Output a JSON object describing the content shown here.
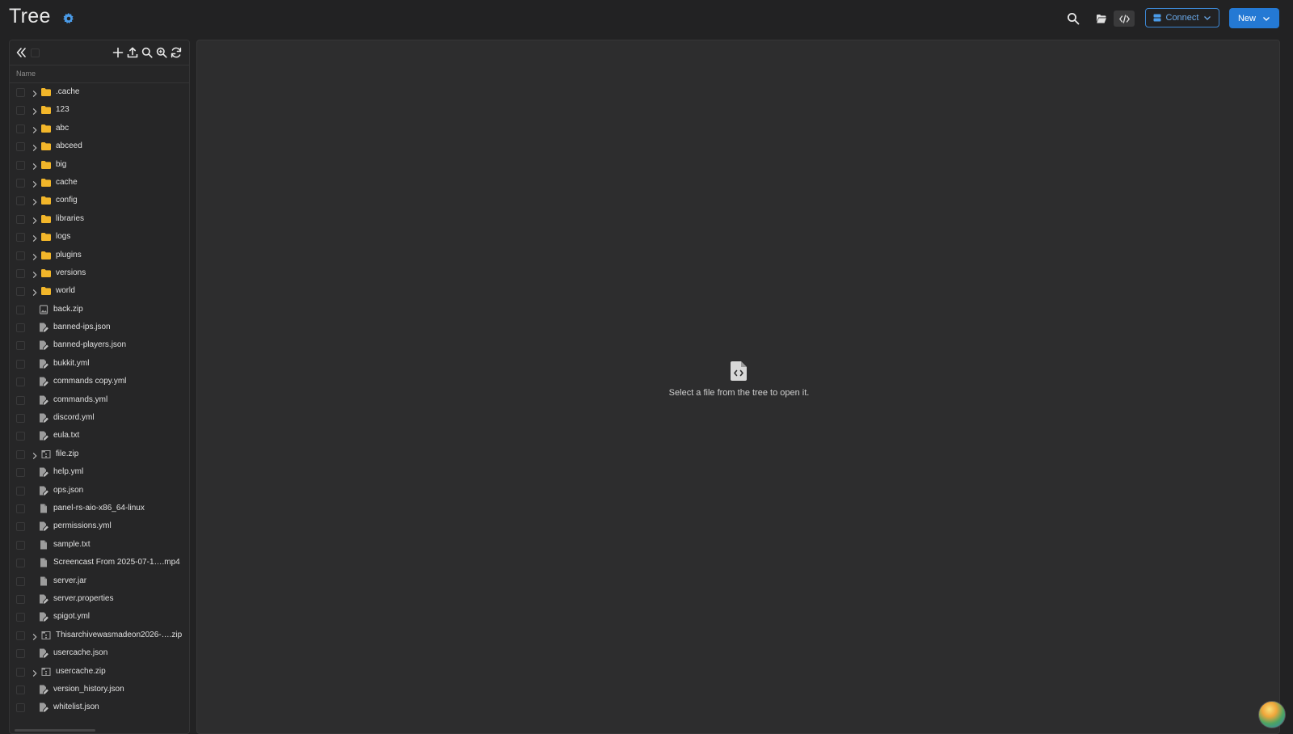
{
  "header": {
    "title": "Tree",
    "connect_label": "Connect",
    "new_label": "New"
  },
  "sidebar": {
    "column_name": "Name"
  },
  "tree": {
    "items": [
      {
        "name": ".cache",
        "kind": "folder"
      },
      {
        "name": "123",
        "kind": "folder"
      },
      {
        "name": "abc",
        "kind": "folder"
      },
      {
        "name": "abceed",
        "kind": "folder"
      },
      {
        "name": "big",
        "kind": "folder"
      },
      {
        "name": "cache",
        "kind": "folder"
      },
      {
        "name": "config",
        "kind": "folder"
      },
      {
        "name": "libraries",
        "kind": "folder"
      },
      {
        "name": "logs",
        "kind": "folder"
      },
      {
        "name": "plugins",
        "kind": "folder"
      },
      {
        "name": "versions",
        "kind": "folder"
      },
      {
        "name": "world",
        "kind": "folder"
      },
      {
        "name": "back.zip",
        "kind": "image"
      },
      {
        "name": "banned-ips.json",
        "kind": "edit"
      },
      {
        "name": "banned-players.json",
        "kind": "edit"
      },
      {
        "name": "bukkit.yml",
        "kind": "edit"
      },
      {
        "name": "commands copy.yml",
        "kind": "edit"
      },
      {
        "name": "commands.yml",
        "kind": "edit"
      },
      {
        "name": "discord.yml",
        "kind": "edit"
      },
      {
        "name": "eula.txt",
        "kind": "edit"
      },
      {
        "name": "file.zip",
        "kind": "archive"
      },
      {
        "name": "help.yml",
        "kind": "edit"
      },
      {
        "name": "ops.json",
        "kind": "edit"
      },
      {
        "name": "panel-rs-aio-x86_64-linux",
        "kind": "file"
      },
      {
        "name": "permissions.yml",
        "kind": "edit"
      },
      {
        "name": "sample.txt",
        "kind": "file"
      },
      {
        "name": "Screencast From 2025-07-1….mp4",
        "kind": "file"
      },
      {
        "name": "server.jar",
        "kind": "file"
      },
      {
        "name": "server.properties",
        "kind": "edit"
      },
      {
        "name": "spigot.yml",
        "kind": "edit"
      },
      {
        "name": "Thisarchivewasmadeon2026-….zip",
        "kind": "archive"
      },
      {
        "name": "usercache.json",
        "kind": "edit"
      },
      {
        "name": "usercache.zip",
        "kind": "archive"
      },
      {
        "name": "version_history.json",
        "kind": "edit"
      },
      {
        "name": "whitelist.json",
        "kind": "edit"
      }
    ]
  },
  "main": {
    "empty_message": "Select a file from the tree to open it."
  },
  "colors": {
    "accent": "#2479d4",
    "folder": "#f2b62a",
    "background": "#222223",
    "panel": "#2d2d2e"
  },
  "icons": {
    "settings": "gear-icon",
    "search": "search-icon",
    "folder_view": "folder-open-icon",
    "code_view": "code-icon",
    "connect": "server-icon",
    "collapse": "double-chevron-left-icon",
    "add": "plus-icon",
    "upload": "upload-icon",
    "find": "search-icon",
    "find_content": "search-content-icon",
    "refresh": "refresh-icon",
    "empty_state": "file-code-icon"
  }
}
